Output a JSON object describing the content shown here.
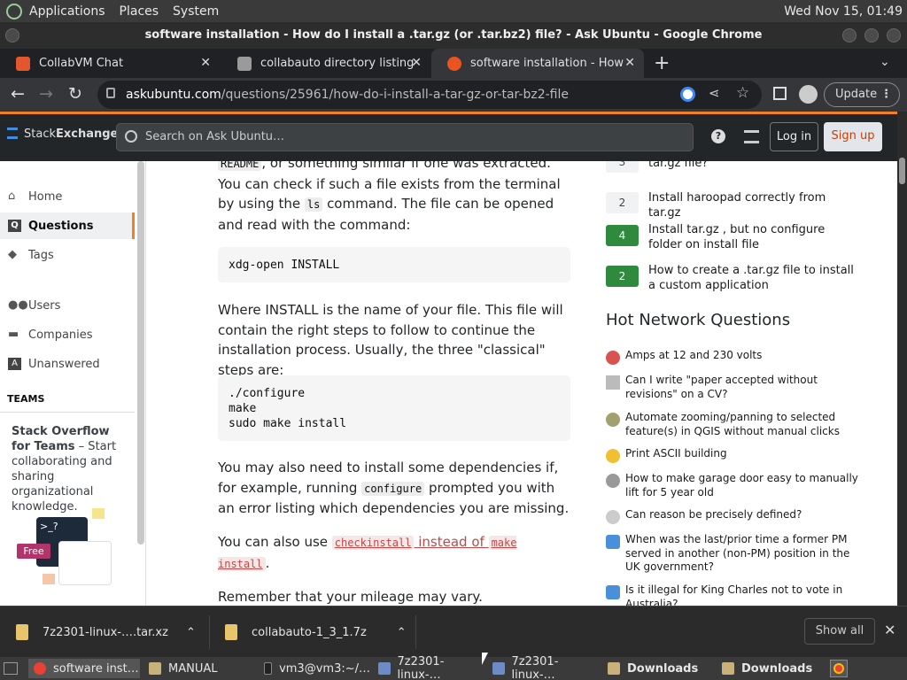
{
  "system_bar": {
    "menus": [
      "Applications",
      "Places",
      "System"
    ],
    "clock": "Wed Nov 15, 01:49"
  },
  "window": {
    "title": "software installation - How do I install a .tar.gz (or .tar.bz2) file? - Ask Ubuntu - Google Chrome"
  },
  "tabs": [
    {
      "label": "CollabVM Chat",
      "color": "#e4572e"
    },
    {
      "label": "collabauto directory listing",
      "color": "#cccccc"
    },
    {
      "label": "software installation - How do",
      "color": "#e95420",
      "active": true
    }
  ],
  "toolbar": {
    "url_host": "askubuntu.com",
    "url_path": "/questions/25961/how-do-i-install-a-tar-gz-or-tar-bz2-file",
    "update_label": "Update"
  },
  "se_header": {
    "logo_stack": "Stack",
    "logo_exchange": "Exchange",
    "search_placeholder": "Search on Ask Ubuntu…",
    "login": "Log in",
    "signup": "Sign up",
    "accent": "#f48024"
  },
  "nav": {
    "items": [
      {
        "label": "Home",
        "icon": "home-icon"
      },
      {
        "label": "Questions",
        "icon": "questions-icon",
        "selected": true
      },
      {
        "label": "Tags",
        "icon": "tag-icon"
      },
      {
        "label": "Users",
        "icon": "users-icon"
      },
      {
        "label": "Companies",
        "icon": "briefcase-icon"
      },
      {
        "label": "Unanswered",
        "icon": "unanswered-icon"
      }
    ],
    "teams_heading": "TEAMS",
    "teams_bold": "Stack Overflow for Teams",
    "teams_text": " – Start collaborating and sharing organizational knowledge.",
    "free_label": "Free",
    "prompt": ">_?"
  },
  "answer": {
    "p1": {
      "a": "README",
      "b": ", or something similar if one was extracted. You can check if such a file exists from the terminal by using the ",
      "c": "ls",
      "d": " command. The file can be opened and read with the command:"
    },
    "code1": "xdg-open INSTALL",
    "p2": "Where INSTALL is the name of your file. This file will contain the right steps to follow to continue the installation process. Usually, the three \"classical\" steps are:",
    "code2": "./configure\nmake\nsudo make install",
    "p3": {
      "a": "You may also need to install some dependencies if, for example, running ",
      "b": "configure",
      "c": " prompted you with an error listing which dependencies you are missing."
    },
    "p4": {
      "a": "You can also use ",
      "b": "checkinstall",
      "c": " instead of ",
      "d": "make install",
      "e": "."
    },
    "p5": "Remember that your mileage may vary."
  },
  "related": [
    {
      "count": "3",
      "text": "tar.gz file?",
      "answered": false
    },
    {
      "count": "2",
      "text": "Install haroopad correctly from tar.gz",
      "answered": false
    },
    {
      "count": "4",
      "text": "Install tar.gz , but no configure folder on install file",
      "answered": true
    },
    {
      "count": "2",
      "text": "How to create a .tar.gz file to install a custom application",
      "answered": true
    }
  ],
  "hot_network": {
    "heading": "Hot Network Questions",
    "items": [
      {
        "text": "Amps at 12 and 230 volts",
        "color": "#d9534f"
      },
      {
        "text": "Can I write \"paper accepted without revisions\" on a CV?",
        "color": "#888888"
      },
      {
        "text": "Automate zooming/panning to selected feature(s) in QGIS without manual clicks",
        "color": "#a0a070"
      },
      {
        "text": "Print ASCII building",
        "color": "#f0c030"
      },
      {
        "text": "How to make garage door easy to manually lift for 5 year old",
        "color": "#999999"
      },
      {
        "text": "Can reason be precisely defined?",
        "color": "#666666"
      },
      {
        "text": "When was the last/prior time a former PM served in another (non-PM) position in the UK government?",
        "color": "#4a90d9"
      },
      {
        "text": "Is it illegal for King Charles not to vote in Australia?",
        "color": "#4a90d9"
      }
    ]
  },
  "downloads": {
    "items": [
      "7z2301-linux-….tar.xz",
      "collabauto-1_3_1.7z"
    ],
    "show_all": "Show all"
  },
  "taskbar": {
    "items": [
      "software inst…",
      "MANUAL",
      "vm3@vm3:~/…",
      "7z2301-linux-…",
      "7z2301-linux-…",
      "Downloads",
      "Downloads"
    ]
  }
}
